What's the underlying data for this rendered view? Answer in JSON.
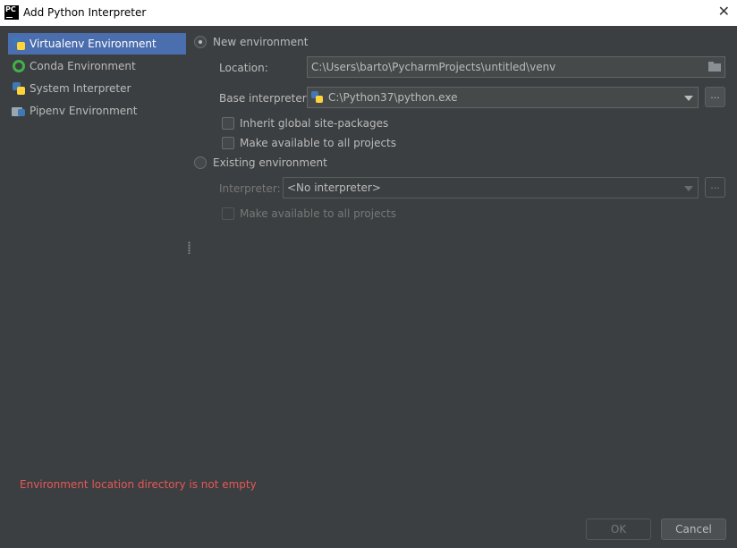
{
  "window": {
    "title": "Add Python Interpreter",
    "app_icon_text": "PC"
  },
  "sidebar": {
    "items": [
      {
        "label": "Virtualenv Environment",
        "icon": "python-icon",
        "selected": true
      },
      {
        "label": "Conda Environment",
        "icon": "conda-icon",
        "selected": false
      },
      {
        "label": "System Interpreter",
        "icon": "python-icon",
        "selected": false
      },
      {
        "label": "Pipenv Environment",
        "icon": "pipenv-icon",
        "selected": false
      }
    ]
  },
  "new_env": {
    "radio_label": "New environment",
    "checked": true,
    "location_label": "Location:",
    "location_value": "C:\\Users\\barto\\PycharmProjects\\untitled\\venv",
    "base_label": "Base interpreter:",
    "base_value": "C:\\Python37\\python.exe",
    "browse_label": "...",
    "inherit_label": "Inherit global site-packages",
    "make_available_label": "Make available to all projects"
  },
  "existing_env": {
    "radio_label": "Existing environment",
    "checked": false,
    "interpreter_label": "Interpreter:",
    "interpreter_value": "<No interpreter>",
    "browse_label": "...",
    "make_available_label": "Make available to all projects"
  },
  "error_message": "Environment location directory is not empty",
  "buttons": {
    "ok": "OK",
    "cancel": "Cancel"
  },
  "colors": {
    "selection": "#4b6eaf",
    "error": "#e65757",
    "background": "#3c3f41"
  }
}
